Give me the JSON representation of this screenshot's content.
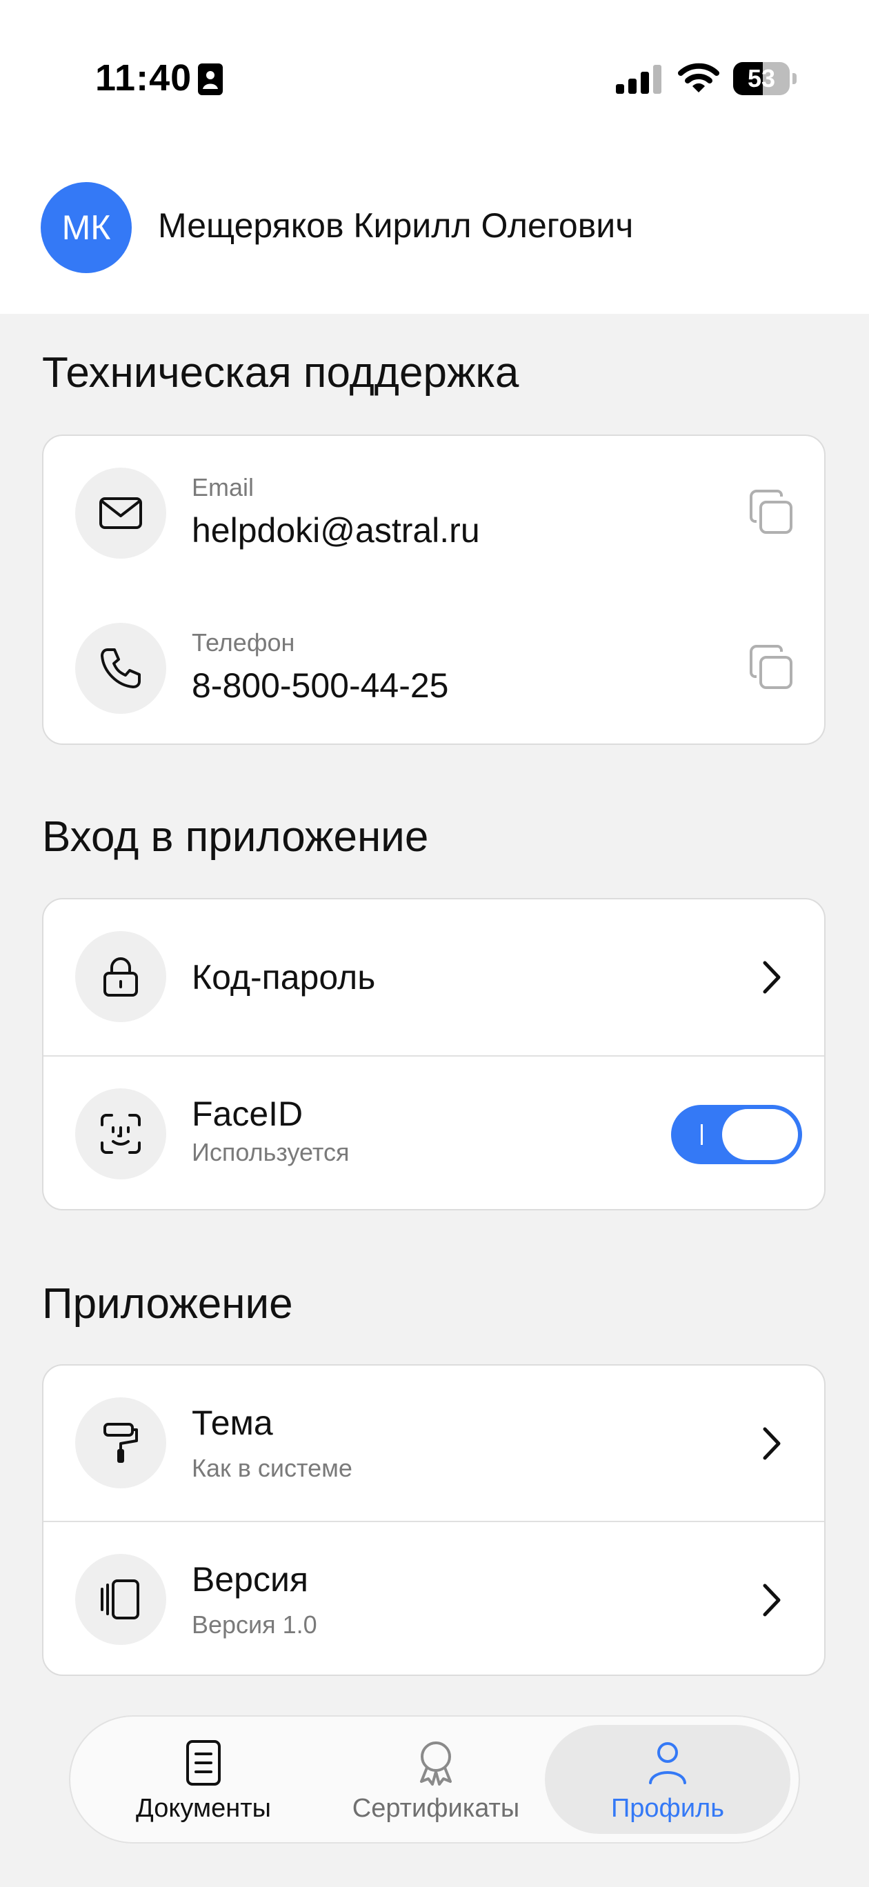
{
  "status_bar": {
    "time": "11:40",
    "battery": "53",
    "battery_level": 0.53
  },
  "header": {
    "avatar_initials": "МК",
    "user_name": "Мещеряков Кирилл Олегович"
  },
  "support": {
    "title": "Техническая поддержка",
    "email_label": "Email",
    "email_value": "helpdoki@astral.ru",
    "phone_label": "Телефон",
    "phone_value": "8-800-500-44-25"
  },
  "login": {
    "title": "Вход в приложение",
    "passcode_label": "Код-пароль",
    "faceid_label": "FaceID",
    "faceid_status": "Используется",
    "faceid_enabled": true
  },
  "app": {
    "title": "Приложение",
    "theme_label": "Тема",
    "theme_value": "Как в системе",
    "version_label": "Версия",
    "version_value": "Версия 1.0"
  },
  "tabbar": {
    "documents": "Документы",
    "certificates": "Сертификаты",
    "profile": "Профиль",
    "active": "profile"
  },
  "colors": {
    "accent": "#3479f6",
    "background": "#f2f2f2",
    "card": "#ffffff"
  }
}
